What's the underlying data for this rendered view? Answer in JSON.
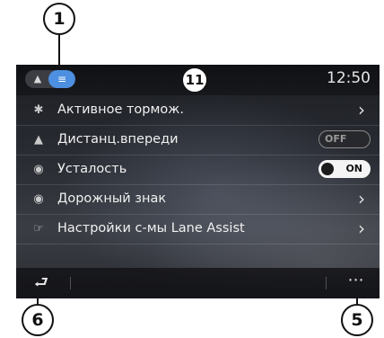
{
  "callouts": {
    "c1": "1",
    "c11": "11",
    "c6": "6",
    "c5": "5"
  },
  "topbar": {
    "clock": "12:50",
    "seg_car_icon": "car-icon",
    "seg_list_icon": "list-icon"
  },
  "menu": {
    "items": [
      {
        "label": "Активное тормож.",
        "icon": "brake-icon",
        "control": "chevron"
      },
      {
        "label": "Дистанц.впереди",
        "icon": "distance-icon",
        "control": "toggle",
        "state": "OFF"
      },
      {
        "label": "Усталость",
        "icon": "eye-icon",
        "control": "toggle",
        "state": "ON"
      },
      {
        "label": "Дорожный знак",
        "icon": "speed-sign-icon",
        "control": "chevron"
      },
      {
        "label": "Настройки с-мы Lane Assist",
        "icon": "lane-assist-icon",
        "control": "chevron"
      }
    ]
  },
  "bottombar": {
    "back_icon": "back-icon",
    "more_icon": "more-icon"
  },
  "colors": {
    "accent": "#4d8fe0",
    "background": "#1c1e23",
    "text": "#f0f0f0"
  }
}
